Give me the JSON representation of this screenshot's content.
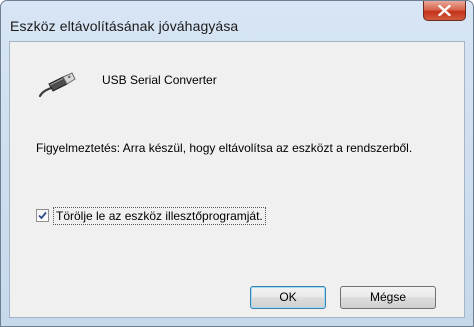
{
  "window": {
    "title": "Eszköz eltávolításának jóváhagyása"
  },
  "titlebar": {
    "close_icon": "close-icon"
  },
  "device": {
    "icon": "usb-plug-icon",
    "name": "USB Serial Converter"
  },
  "warning": {
    "text": "Figyelmeztetés: Arra készül, hogy eltávolítsa az eszközt a rendszerből."
  },
  "driver_option": {
    "label": "Törölje le az eszköz illesztőprogramját.",
    "checked": true
  },
  "buttons": {
    "ok_label": "OK",
    "cancel_label": "Mégse"
  },
  "colors": {
    "close_button": "#c2331a",
    "frame": "#c6d8ec",
    "client": "#f0f0f0"
  }
}
